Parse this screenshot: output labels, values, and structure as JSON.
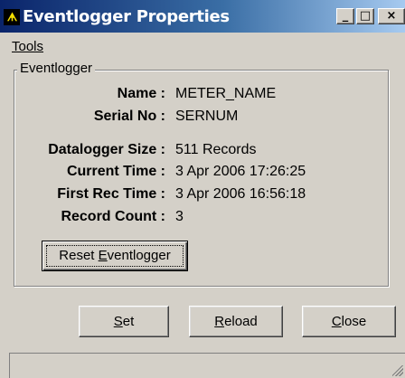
{
  "window": {
    "title": "Eventlogger Properties",
    "icon_text": "ᗗ"
  },
  "titlebar_buttons": {
    "minimize": "_",
    "maximize": "□",
    "close": "×"
  },
  "menu": {
    "tools_label": "Tools"
  },
  "group": {
    "legend": "Eventlogger",
    "fields": [
      {
        "label": "Name :",
        "value": "METER_NAME"
      },
      {
        "label": "Serial No :",
        "value": "SERNUM"
      },
      {
        "label": "Datalogger Size :",
        "value": "511 Records"
      },
      {
        "label": "Current Time :",
        "value": "3 Apr 2006 17:26:25"
      },
      {
        "label": "First Rec Time :",
        "value": "3 Apr 2006 16:56:18"
      },
      {
        "label": "Record Count :",
        "value": "3"
      }
    ],
    "reset_button": {
      "before": "Reset ",
      "underline": "E",
      "after": "ventlogger"
    }
  },
  "buttons": {
    "set": {
      "underline": "S",
      "after": "et"
    },
    "reload": {
      "underline": "R",
      "after": "eload"
    },
    "close": {
      "underline": "C",
      "after": "lose"
    }
  },
  "status": {
    "text": ""
  }
}
